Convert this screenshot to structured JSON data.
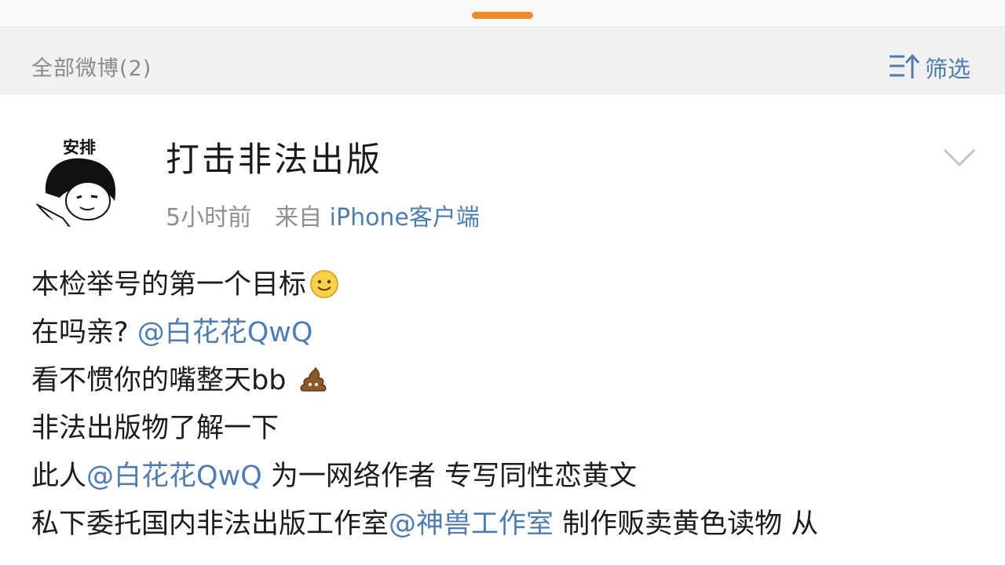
{
  "tab_bar": {
    "active_indicator_color": "#f08a2b"
  },
  "filter_bar": {
    "title": "全部微博(2)",
    "filter_label": "筛选",
    "filter_icon": "filter-sort-icon"
  },
  "post": {
    "avatar": {
      "caption": "安排",
      "icon": "meme-face-avatar"
    },
    "author": "打击非法出版",
    "time": "5小时前",
    "source_prefix": "来自",
    "source": "iPhone客户端",
    "menu_icon": "chevron-down-icon",
    "lines": [
      {
        "text": "本检举号的第一个目标",
        "emoji": "smile-emoji"
      },
      {
        "text": "在吗亲? ",
        "mention": "@白花花QwQ"
      },
      {
        "text": "看不惯你的嘴整天bb ",
        "emoji": "poop-emoji"
      },
      {
        "text": "非法出版物了解一下"
      },
      {
        "prefix": "此人",
        "mention": "@白花花QwQ",
        "suffix": " 为一网络作者 专写同性恋黄文"
      },
      {
        "prefix": "私下委托国内非法出版工作室",
        "mention": "@神兽工作室",
        "suffix": " 制作贩卖黄色读物 从"
      }
    ]
  },
  "colors": {
    "link_blue": "#4f7db0",
    "meta_gray": "#8f8f8f",
    "filter_bar_bg": "#f1f1f1"
  }
}
